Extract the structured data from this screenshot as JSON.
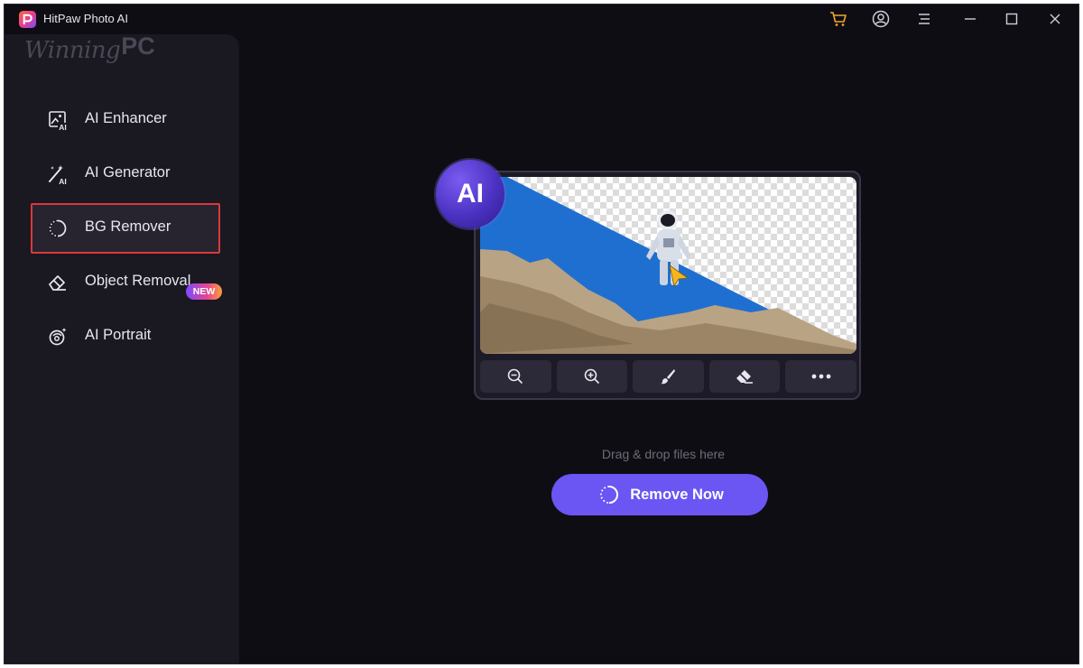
{
  "app": {
    "title": "HitPaw Photo AI"
  },
  "titlebar": {
    "icons": [
      "cart-icon",
      "account-icon",
      "menu-icon",
      "minimize-icon",
      "maximize-icon",
      "close-icon"
    ]
  },
  "watermark": {
    "script": "Winning",
    "suffix": "PC"
  },
  "sidebar": {
    "items": [
      {
        "label": "AI Enhancer",
        "icon": "ai-enhancer-icon"
      },
      {
        "label": "AI Generator",
        "icon": "magic-wand-icon"
      },
      {
        "label": "BG Remover",
        "icon": "bg-remover-icon",
        "active": true
      },
      {
        "label": "Object Removal",
        "icon": "eraser-icon"
      },
      {
        "label": "AI Portrait",
        "icon": "portrait-icon",
        "badge": "NEW"
      }
    ]
  },
  "preview": {
    "ai_badge": "AI",
    "tools": [
      "zoom-out-icon",
      "zoom-in-icon",
      "brush-icon",
      "eraser-icon",
      "more-icon"
    ]
  },
  "main": {
    "drag_text": "Drag & drop files here",
    "remove_button": "Remove Now"
  },
  "colors": {
    "accent": "#6b55f3",
    "highlight": "#d9393b",
    "sky": "#1f6fd0"
  }
}
